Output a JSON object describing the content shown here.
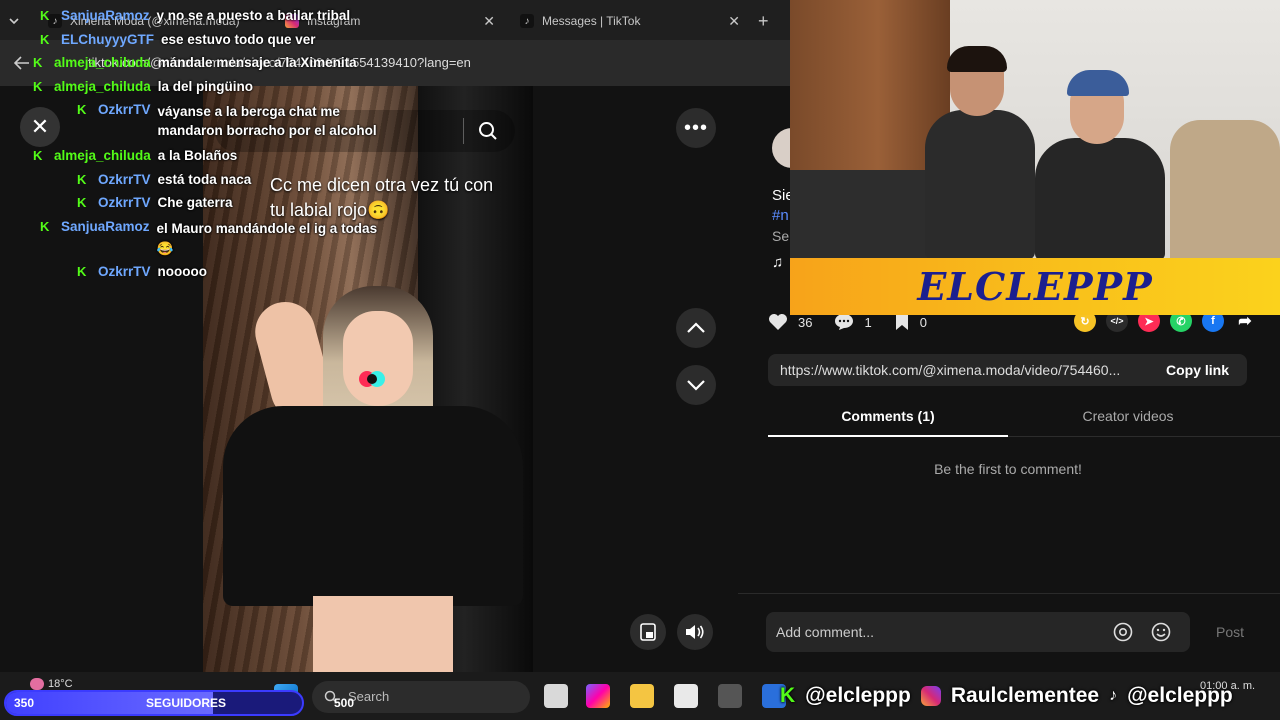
{
  "browser": {
    "tabs": [
      {
        "label": "Ximena Moda (@ximena.moda)"
      },
      {
        "label": "Instagram"
      },
      {
        "label": "Messages | TikTok"
      }
    ],
    "url": "tiktok.com/@ximena.moda/video/7544604891554139410?lang=en"
  },
  "video": {
    "search_placeholder": "Find related content",
    "caption": "Cc me dicen otra vez tú con tu labial rojo🙃"
  },
  "chat": [
    {
      "user": "SanjuaRamoz",
      "message": "y no se a puesto a bailar tribal",
      "color": "#6fa8ff"
    },
    {
      "user": "ELChuyyyGTF",
      "message": "ese estuvo todo que ver",
      "color": "#6fa8ff"
    },
    {
      "user": "almeja_chiluda",
      "message": "mándale mensaje a la Ximenita",
      "color": "#53fc18"
    },
    {
      "user": "almeja_chiluda",
      "message": "la del pingüino",
      "color": "#53fc18"
    },
    {
      "user": "OzkrrTV",
      "message": "váyanse a la bercga chat me",
      "message2": "mandaron borracho por el alcohol",
      "color": "#6fa8ff"
    },
    {
      "user": "almeja_chiluda",
      "message": "a la Bolaños",
      "color": "#53fc18"
    },
    {
      "user": "OzkrrTV",
      "message": "está toda naca",
      "color": "#6fa8ff"
    },
    {
      "user": "OzkrrTV",
      "message": "Che gaterra",
      "color": "#6fa8ff"
    },
    {
      "user": "SanjuaRamoz",
      "message": "el Mauro mandándole el ig a todas",
      "message2": "😂",
      "color": "#6fa8ff"
    },
    {
      "user": "OzkrrTV",
      "message": "nooooo",
      "color": "#6fa8ff"
    }
  ],
  "post": {
    "side_fragments": [
      "Sie",
      "#n",
      "Se",
      "♫"
    ],
    "likes": "36",
    "comments": "1",
    "saves": "0",
    "link": "https://www.tiktok.com/@ximena.moda/video/754460...",
    "copy_label": "Copy link",
    "tab_comments": "Comments (1)",
    "tab_creator": "Creator videos",
    "empty": "Be the first to comment!",
    "comment_placeholder": "Add comment...",
    "post_label": "Post"
  },
  "stream": {
    "banner": "ELCLEPPP",
    "goal_label": "SEGUIDORES",
    "goal_current": "350",
    "goal_target": "500",
    "goal_fraction": 0.7,
    "weather": "18°C",
    "socials": [
      "@elcleppp",
      "Raulclementee",
      "@elcleppp"
    ],
    "clock": "01:00 a. m."
  },
  "taskbar": {
    "search_placeholder": "Search"
  },
  "colors": {
    "kick_green": "#53fc18",
    "banner_text": "#1b1f8f",
    "banner_bg": "#f9c21b"
  }
}
